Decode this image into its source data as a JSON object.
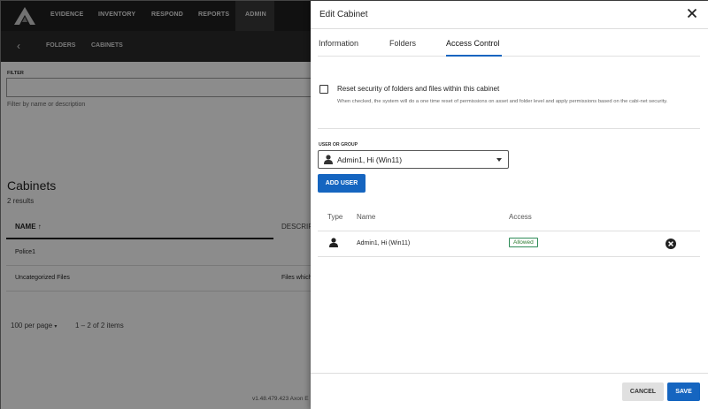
{
  "app": {
    "nav": [
      "EVIDENCE",
      "INVENTORY",
      "RESPOND",
      "REPORTS",
      "ADMIN"
    ],
    "subnav": [
      "FOLDERS",
      "CABINETS"
    ],
    "back_icon": "chevron-left-icon",
    "filter": {
      "label": "FILTER",
      "hint": "Filter by name or description",
      "value": ""
    },
    "cabinets_title": "Cabinets",
    "results_count": "2 results",
    "columns": {
      "name": "NAME",
      "description": "DESCRIP"
    },
    "rows": [
      {
        "name": "Police1",
        "description": ""
      },
      {
        "name": "Uncategorized Files",
        "description": "Files which"
      }
    ],
    "pager": {
      "per_page": "100 per page",
      "range": "1 – 2 of 2 items"
    },
    "version": "v1.48.479.423 Axon E"
  },
  "dialog": {
    "title": "Edit Cabinet",
    "tabs": [
      "Information",
      "Folders",
      "Access Control"
    ],
    "active_tab": "Access Control",
    "reset_checkbox": {
      "label": "Reset security of folders and files within this cabinet",
      "help": "When checked, the system will do a one time reset of permissions on asset and folder level and apply permissions based on the cabi-net security.",
      "checked": false
    },
    "user_or_group": {
      "label": "USER OR GROUP",
      "value": "Admin1, Hi (Win11)"
    },
    "add_user_label": "ADD USER",
    "table": {
      "headers": [
        "Type",
        "Name",
        "Access"
      ],
      "rows": [
        {
          "type_icon": "person-icon",
          "name": "Admin1, Hi (Win11)",
          "access": "Allowed"
        }
      ]
    },
    "cancel_label": "CANCEL",
    "save_label": "SAVE"
  },
  "colors": {
    "primary": "#1565c0",
    "allowed": "#2e7d32",
    "nav_bg": "#202020",
    "accent": "#f0b400"
  }
}
